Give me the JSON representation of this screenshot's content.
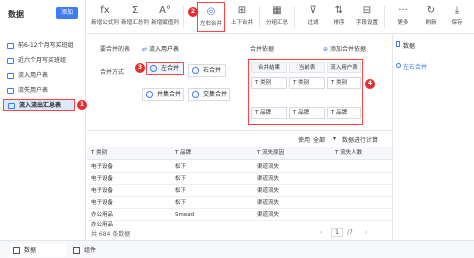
{
  "sidebar": {
    "title": "数据",
    "add_label": "添加",
    "items": [
      {
        "label": "前6-12个月写买班组"
      },
      {
        "label": "近六个月写买班组"
      },
      {
        "label": "流入用户表"
      },
      {
        "label": "流失用户表"
      },
      {
        "label": "流入流出汇总表"
      }
    ]
  },
  "toolbar": {
    "buttons": [
      {
        "glyph": "fx",
        "label": "新增公式列"
      },
      {
        "glyph": "Σ",
        "label": "新增汇总列"
      },
      {
        "glyph": "A°",
        "label": "新增赋值列"
      },
      {
        "glyph": "◎",
        "label": "左右合并"
      },
      {
        "glyph": "⊞",
        "label": "上下合并"
      },
      {
        "glyph": "▦",
        "label": "分组汇总"
      },
      {
        "glyph": "⊽",
        "label": "过滤"
      },
      {
        "glyph": "⇅",
        "label": "排序"
      },
      {
        "glyph": "⊟",
        "label": "字段设置"
      },
      {
        "glyph": "···",
        "label": "更多"
      },
      {
        "glyph": "↻",
        "label": "刷新"
      },
      {
        "glyph": "⤓",
        "label": "保存"
      }
    ]
  },
  "config": {
    "table_to_merge_label": "要合并的表",
    "table_to_merge_value": "流入用户表",
    "merge_method_label": "合并方式",
    "methods": [
      "左合并",
      "右合并",
      "并集合并",
      "交集合并"
    ],
    "merge_basis_label": "合并依据",
    "add_basis_label": "添加合并依据",
    "grid_headers": [
      "合并结果",
      "当前表",
      "流入用户表"
    ],
    "grid_rows": [
      [
        "T 类别",
        "T 类别",
        "T 类别"
      ],
      [
        "T 品牌",
        "T 品牌",
        "T 品牌"
      ]
    ]
  },
  "preview": {
    "use_label": "使用",
    "use_value": "全部",
    "calc_label": "数据进行计算",
    "columns": [
      "类别",
      "品牌",
      "流失原因",
      "流失人数"
    ],
    "rows": [
      [
        "电子设备",
        "松下",
        "渠道流失",
        ""
      ],
      [
        "电子设备",
        "松下",
        "渠道流失",
        ""
      ],
      [
        "电子设备",
        "松下",
        "渠道流失",
        ""
      ],
      [
        "电子设备",
        "松下",
        "渠道流失",
        ""
      ],
      [
        "办公用品",
        "Smead",
        "渠道流失",
        ""
      ],
      [
        "办公用品",
        "",
        "",
        ""
      ]
    ],
    "footer": "共 684 条数据",
    "page_current": "1",
    "page_total": "/7"
  },
  "right_panel": {
    "title": "数据",
    "item": "左右合并"
  },
  "bottom_tabs": [
    "数据",
    "组件"
  ],
  "badges": [
    "1",
    "2",
    "3",
    "4"
  ],
  "colors": {
    "accent": "#3d7cf5",
    "highlight": "#f44",
    "badge": "#e62e2e"
  }
}
